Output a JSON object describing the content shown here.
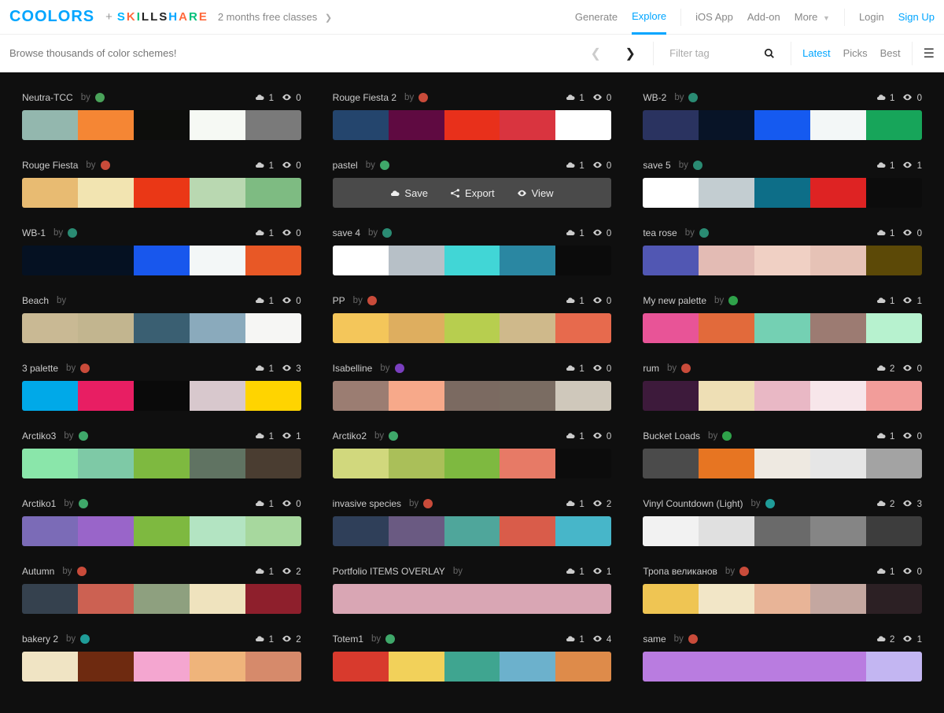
{
  "topbar": {
    "logo": "COOLORS",
    "plus": "+",
    "skillshare": {
      "S": "S",
      "K": "K",
      "I": "I",
      "L1": "L",
      "L2": "L",
      "S2": "S",
      "H": "H",
      "A": "A",
      "R": "R",
      "E": "E"
    },
    "promo": "2 months free classes",
    "nav": {
      "generate": "Generate",
      "explore": "Explore",
      "ios": "iOS App",
      "addon": "Add-on",
      "more": "More"
    },
    "auth": {
      "login": "Login",
      "signup": "Sign Up"
    }
  },
  "browsebar": {
    "title": "Browse thousands of color schemes!",
    "filter_placeholder": "Filter tag",
    "sort": {
      "latest": "Latest",
      "picks": "Picks",
      "best": "Best"
    }
  },
  "overlay": {
    "save": "Save",
    "export": "Export",
    "view": "View"
  },
  "by": "by",
  "palettes": [
    [
      {
        "name": "Neutra-TCC",
        "dot": "#4aa35a",
        "dl": 1,
        "v": 0,
        "colors": [
          "#93b7ae",
          "#f58634",
          "#0d0e0c",
          "#f6f9f4",
          "#7a7a7a"
        ]
      },
      {
        "name": "Rouge Fiesta 2",
        "dot": "#c94b3a",
        "dl": 1,
        "v": 0,
        "colors": [
          "#24456d",
          "#5f0a41",
          "#e8301b",
          "#d9343f",
          "#ffffff"
        ]
      },
      {
        "name": "WB-2",
        "dot": "#2a8b73",
        "dl": 1,
        "v": 0,
        "colors": [
          "#2a3360",
          "#081427",
          "#155af0",
          "#f3f7f7",
          "#17a55a"
        ]
      }
    ],
    [
      {
        "name": "Rouge Fiesta",
        "dot": "#c94b3a",
        "dl": 1,
        "v": 0,
        "colors": [
          "#e8bb72",
          "#f2e4b1",
          "#ea3716",
          "#b9d8b1",
          "#7ebb82"
        ]
      },
      {
        "name": "pastel",
        "dot": "#3fa86a",
        "dl": 1,
        "v": 0,
        "overlay": true
      },
      {
        "name": "save 5",
        "dot": "#2a8b73",
        "dl": 1,
        "v": 1,
        "colors": [
          "#ffffff",
          "#c3cdd1",
          "#0d6e88",
          "#de2323",
          "#0c0c0c"
        ]
      }
    ],
    [
      {
        "name": "WB-1",
        "dot": "#2a8b73",
        "dl": 1,
        "v": 0,
        "colors": [
          "#051122",
          "#051122",
          "#1857ed",
          "#f3f7f7",
          "#e85826"
        ]
      },
      {
        "name": "save 4",
        "dot": "#2a8b73",
        "dl": 1,
        "v": 0,
        "colors": [
          "#ffffff",
          "#b7c0c7",
          "#41d6d6",
          "#2a87a2",
          "#0b0b0b"
        ]
      },
      {
        "name": "tea rose",
        "dot": "#2a8b73",
        "dl": 1,
        "v": 0,
        "colors": [
          "#5157b3",
          "#e3bbb4",
          "#f0d0c4",
          "#e6c2b6",
          "#5c4907"
        ]
      }
    ],
    [
      {
        "name": "Beach",
        "dot": "",
        "dl": 1,
        "v": 0,
        "colors": [
          "#c9b994",
          "#c2b58f",
          "#3a5f72",
          "#8aaabc",
          "#f6f6f4"
        ]
      },
      {
        "name": "PP",
        "dot": "#c94b3a",
        "dl": 1,
        "v": 0,
        "colors": [
          "#f4c65a",
          "#deae5f",
          "#b7ce4f",
          "#cfb98b",
          "#e76a4d"
        ]
      },
      {
        "name": "My new palette",
        "dot": "#2fa24a",
        "dl": 1,
        "v": 1,
        "colors": [
          "#e85497",
          "#e26a3b",
          "#74d0b3",
          "#9c7b72",
          "#b7f2cf"
        ]
      }
    ],
    [
      {
        "name": "3 palette",
        "dot": "#c94b3a",
        "dl": 1,
        "v": 3,
        "colors": [
          "#00a9e8",
          "#e81e63",
          "#0a0a0a",
          "#d8c8cd",
          "#ffd400"
        ]
      },
      {
        "name": "Isabelline",
        "dot": "#7a3fbf",
        "dl": 1,
        "v": 0,
        "colors": [
          "#9b7d72",
          "#f7a98a",
          "#7b6a61",
          "#7a6c62",
          "#cfc8bb"
        ]
      },
      {
        "name": "rum",
        "dot": "#c94b3a",
        "dl": 2,
        "v": 0,
        "colors": [
          "#3d1a3b",
          "#eedfb5",
          "#e9b8c5",
          "#f7e6ea",
          "#f29d9a"
        ]
      }
    ],
    [
      {
        "name": "Arctiko3",
        "dot": "#3fa86a",
        "dl": 1,
        "v": 1,
        "colors": [
          "#8ae6aa",
          "#7ec9a6",
          "#7eb940",
          "#607362",
          "#4a3d31"
        ]
      },
      {
        "name": "Arctiko2",
        "dot": "#3fa86a",
        "dl": 1,
        "v": 0,
        "colors": [
          "#d1d87d",
          "#aabf59",
          "#7eb940",
          "#e77a66",
          "#0c0c0c"
        ]
      },
      {
        "name": "Bucket Loads",
        "dot": "#2fa24a",
        "dl": 1,
        "v": 0,
        "colors": [
          "#4b4b4b",
          "#e77522",
          "#eee9e1",
          "#e6e6e6",
          "#a3a3a3"
        ]
      }
    ],
    [
      {
        "name": "Arctiko1",
        "dot": "#3fa86a",
        "dl": 1,
        "v": 0,
        "colors": [
          "#7b6bb7",
          "#9965c9",
          "#7eb940",
          "#b3e4c2",
          "#a7d89e"
        ]
      },
      {
        "name": "invasive species",
        "dot": "#c94b3a",
        "dl": 1,
        "v": 2,
        "colors": [
          "#2f3f59",
          "#6a5a82",
          "#4fa69b",
          "#d95c4a",
          "#47b6c9"
        ]
      },
      {
        "name": "Vinyl Countdown (Light)",
        "dot": "#1f9c98",
        "dl": 2,
        "v": 3,
        "colors": [
          "#f2f2f2",
          "#e0e0e0",
          "#6a6a6a",
          "#858585",
          "#3d3d3d"
        ]
      }
    ],
    [
      {
        "name": "Autumn",
        "dot": "#c94b3a",
        "dl": 1,
        "v": 2,
        "colors": [
          "#35414e",
          "#cc6152",
          "#8ea07f",
          "#efe3be",
          "#8e1f2c"
        ]
      },
      {
        "name": "Portfolio ITEMS OVERLAY",
        "dot": "",
        "dl": 1,
        "v": 1,
        "colors": [
          "#d9a6b4",
          "#d9a6b4",
          "#d9a6b4",
          "#d9a6b4",
          "#d9a6b4"
        ]
      },
      {
        "name": "Тропа великанов",
        "dot": "#c94b3a",
        "dl": 1,
        "v": 0,
        "colors": [
          "#efc553",
          "#f2e6c7",
          "#e8b497",
          "#c4a7a0",
          "#2c2024"
        ]
      }
    ],
    [
      {
        "name": "bakery 2",
        "dot": "#1f9c98",
        "dl": 1,
        "v": 2,
        "colors": [
          "#f0e4c4",
          "#6e2a10",
          "#f4a6d0",
          "#efb47b",
          "#d68a6b"
        ]
      },
      {
        "name": "Totem1",
        "dot": "#3fa86a",
        "dl": 1,
        "v": 4,
        "colors": [
          "#d83a2d",
          "#f2d15a",
          "#3fa590",
          "#6cb1cc",
          "#de8b4a"
        ]
      },
      {
        "name": "same",
        "dot": "#c94b3a",
        "dl": 2,
        "v": 1,
        "colors": [
          "#b97ce0",
          "#b97ce0",
          "#b97ce0",
          "#b97ce0",
          "#c3b6f2"
        ]
      }
    ]
  ]
}
